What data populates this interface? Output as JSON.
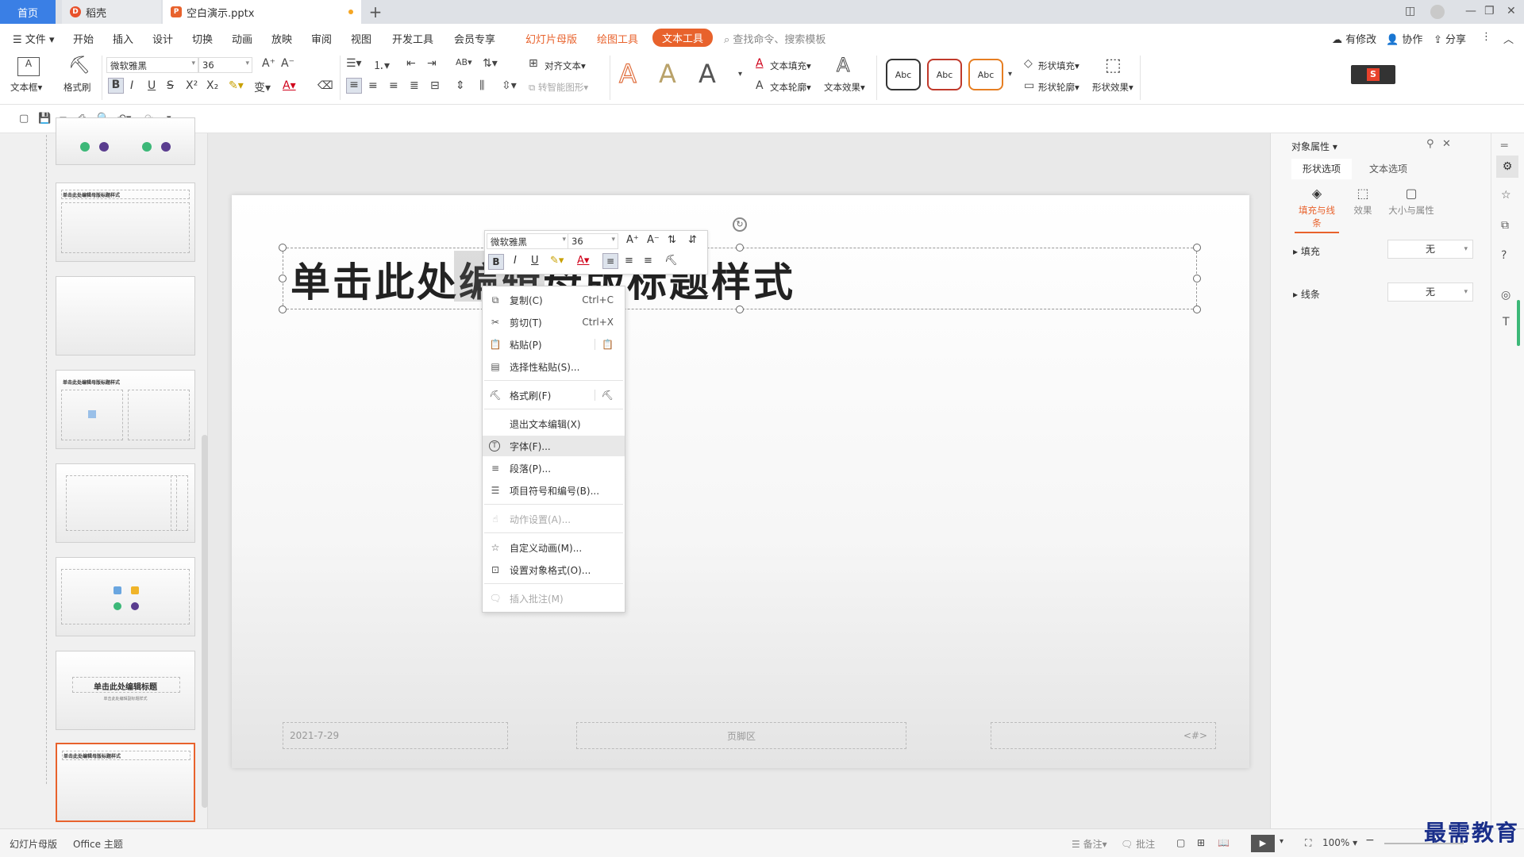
{
  "tabs": {
    "home": "首页",
    "daoke": "稻壳",
    "file": "空白演示.pptx",
    "plus": "+"
  },
  "menu": {
    "file": "文件",
    "start": "开始",
    "insert": "插入",
    "design": "设计",
    "transition": "切换",
    "animation": "动画",
    "slideshow": "放映",
    "review": "审阅",
    "view": "视图",
    "dev": "开发工具",
    "member": "会员专享",
    "master": "幻灯片母版",
    "drawing": "绘图工具",
    "text_tools": "文本工具",
    "search": "查找命令、搜索模板",
    "changes": "有修改",
    "collab": "协作",
    "share": "分享"
  },
  "ribbon": {
    "textbox": "文本框",
    "format_brush": "格式刷",
    "font": "微软雅黑",
    "size": "36",
    "align_text": "对齐文本",
    "smart_shape": "转智能图形",
    "text_fill": "文本填充",
    "text_outline": "文本轮廓",
    "text_effect": "文本效果",
    "shape_fill": "形状填充",
    "shape_outline": "形状轮廓",
    "shape_effect": "形状效果",
    "abc1": "Abc",
    "abc2": "Abc",
    "abc3": "Abc",
    "bigA": "A"
  },
  "slide": {
    "title": "单击此处编辑母版标题样式",
    "date": "2021-7-29",
    "footer": "页脚区",
    "number": "<#>"
  },
  "thumbs": {
    "t_title": "单击此处编辑母版标题样式",
    "t7_title": "单击此处编辑标题",
    "t7_sub": "单击此处编辑副标题样式"
  },
  "minitoolbar": {
    "font": "微软雅黑",
    "size": "36"
  },
  "context_menu": {
    "copy": "复制(C)",
    "copy_sc": "Ctrl+C",
    "cut": "剪切(T)",
    "cut_sc": "Ctrl+X",
    "paste": "粘贴(P)",
    "paste_special": "选择性粘贴(S)...",
    "format_brush": "格式刷(F)",
    "exit_edit": "退出文本编辑(X)",
    "font": "字体(F)...",
    "paragraph": "段落(P)...",
    "bullets": "项目符号和编号(B)...",
    "action": "动作设置(A)...",
    "custom_anim": "自定义动画(M)...",
    "format_object": "设置对象格式(O)...",
    "insert_comment": "插入批注(M)"
  },
  "rightpanel": {
    "title": "对象属性",
    "tab_shape": "形状选项",
    "tab_text": "文本选项",
    "sub_fill": "填充与线条",
    "sub_effect": "效果",
    "sub_size": "大小与属性",
    "fill": "填充",
    "fill_val": "无",
    "line": "线条",
    "line_val": "无"
  },
  "status": {
    "master": "幻灯片母版",
    "theme": "Office 主题",
    "notes": "备注",
    "comments": "批注",
    "zoom": "100%"
  },
  "brand": "最需教育",
  "colors": {
    "accent": "#e8622c",
    "home_tab": "#3a7fe5",
    "brand": "#1a2f8a"
  }
}
